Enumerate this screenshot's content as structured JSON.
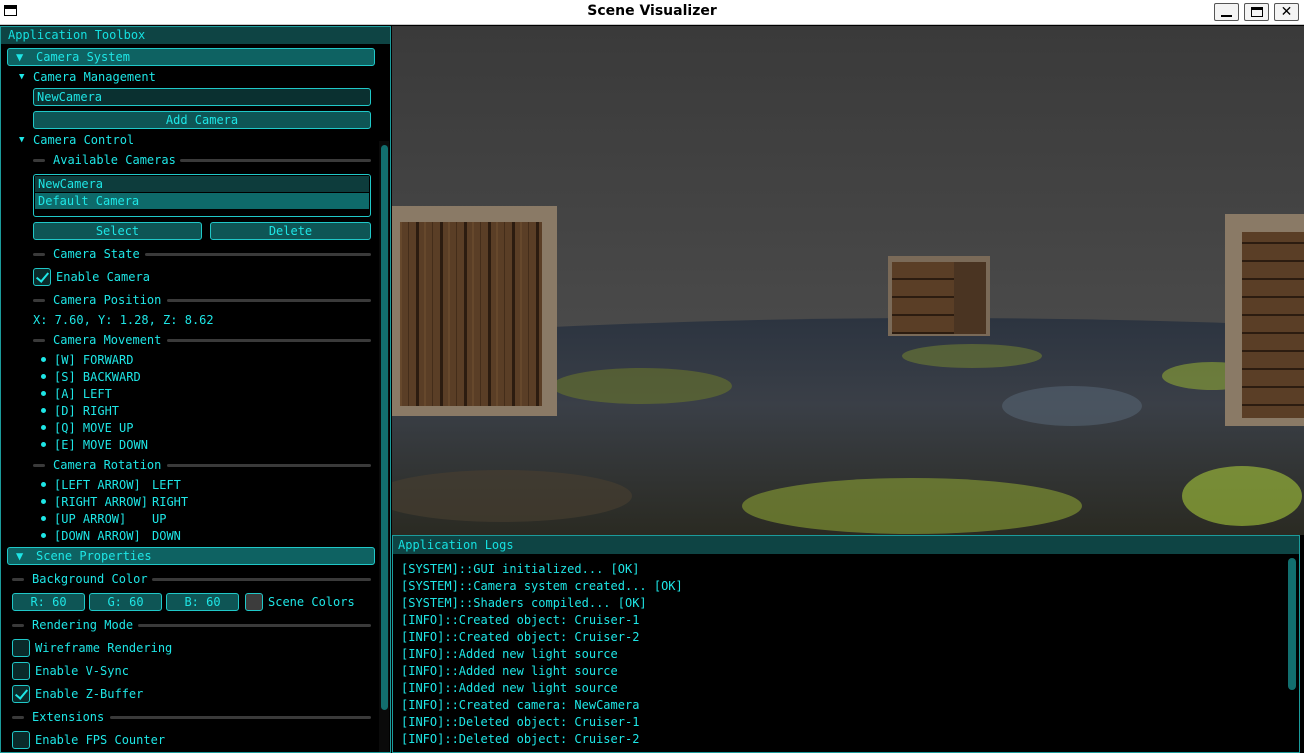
{
  "window": {
    "title": "Scene Visualizer",
    "minimize": "_",
    "maximize": "□",
    "close": "✕"
  },
  "toolbox": {
    "title": "Application Toolbox",
    "camera_system": {
      "header": "Camera System",
      "management": {
        "label": "Camera Management",
        "name_value": "NewCamera",
        "add_button": "Add Camera"
      },
      "control": {
        "label": "Camera Control",
        "available_label": "Available Cameras",
        "cameras": [
          "NewCamera",
          "Default Camera"
        ],
        "selected_index": 1,
        "select_button": "Select",
        "delete_button": "Delete",
        "state_label": "Camera State",
        "enable_label": "Enable Camera",
        "enable_checked": true,
        "position_label": "Camera Position",
        "position_text": "X: 7.60, Y: 1.28, Z: 8.62",
        "movement_label": "Camera Movement",
        "movement_items": [
          "[W] FORWARD",
          "[S] BACKWARD",
          "[A] LEFT",
          "[D] RIGHT",
          "[Q] MOVE UP",
          "[E] MOVE DOWN"
        ],
        "rotation_label": "Camera Rotation",
        "rotation_items": [
          {
            "key": "[LEFT ARROW]",
            "action": "LEFT"
          },
          {
            "key": "[RIGHT ARROW]",
            "action": "RIGHT"
          },
          {
            "key": "[UP ARROW]",
            "action": "UP"
          },
          {
            "key": "[DOWN ARROW]",
            "action": "DOWN"
          }
        ]
      }
    },
    "scene_properties": {
      "header": "Scene Properties",
      "bg_label": "Background Color",
      "r": "R: 60",
      "g": "G: 60",
      "b": "B: 60",
      "swatch_color": "#3c3c3c",
      "scene_colors_label": "Scene Colors",
      "render_label": "Rendering Mode",
      "wireframe": {
        "label": "Wireframe Rendering",
        "checked": false
      },
      "vsync": {
        "label": "Enable V-Sync",
        "checked": false
      },
      "zbuffer": {
        "label": "Enable Z-Buffer",
        "checked": true
      },
      "ext_label": "Extensions",
      "fps": {
        "label": "Enable FPS Counter",
        "checked": false
      }
    }
  },
  "logs": {
    "title": "Application Logs",
    "lines": [
      "[SYSTEM]::GUI initialized... [OK]",
      "[SYSTEM]::Camera system created... [OK]",
      "[SYSTEM]::Shaders compiled... [OK]",
      "[INFO]::Created object: Cruiser-1",
      "[INFO]::Created object: Cruiser-2",
      "[INFO]::Added new light source",
      "[INFO]::Added new light source",
      "[INFO]::Added new light source",
      "[INFO]::Created camera: NewCamera",
      "[INFO]::Deleted object: Cruiser-1",
      "[INFO]::Deleted object: Cruiser-2"
    ]
  },
  "colors": {
    "accent": "#1ee6e6",
    "panel_header": "#0e4444",
    "border": "#1b9b9b",
    "background": "#000000"
  }
}
